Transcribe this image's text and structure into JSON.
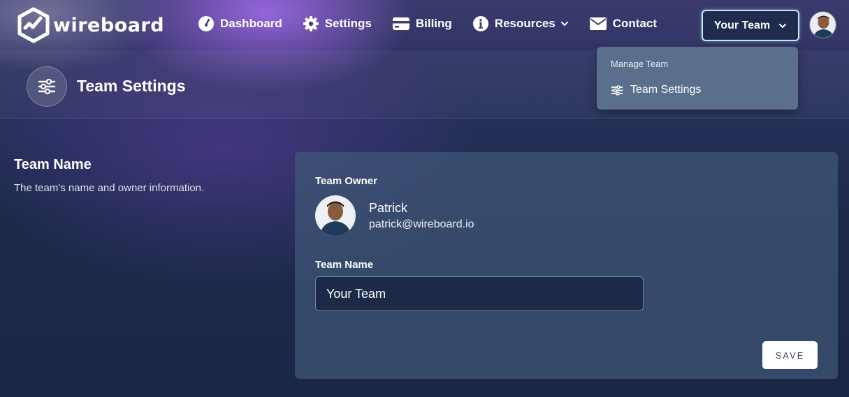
{
  "brand": {
    "name": "wireboard",
    "logo_icon": "hexagon-check-icon"
  },
  "nav": {
    "items": [
      {
        "label": "Dashboard",
        "icon": "gauge-icon"
      },
      {
        "label": "Settings",
        "icon": "gear-icon"
      },
      {
        "label": "Billing",
        "icon": "credit-card-icon"
      },
      {
        "label": "Resources",
        "icon": "info-icon",
        "has_dropdown": true
      },
      {
        "label": "Contact",
        "icon": "envelope-icon"
      }
    ]
  },
  "team_menu": {
    "button_label": "Your Team",
    "heading": "Manage Team",
    "items": [
      {
        "label": "Team Settings",
        "icon": "sliders-icon"
      }
    ]
  },
  "page_header": {
    "title": "Team Settings",
    "icon": "sliders-icon"
  },
  "section": {
    "title": "Team Name",
    "description": "The team's name and owner information."
  },
  "card": {
    "owner_label": "Team Owner",
    "owner": {
      "name": "Patrick",
      "email": "patrick@wireboard.io"
    },
    "name_label": "Team Name",
    "name_value": "Your Team",
    "save_label": "SAVE"
  },
  "colors": {
    "accent_outline": "#bfeef0",
    "dropdown_bg": "#5a6f8c",
    "card_bg": "#405878",
    "input_bg": "#1c2a48"
  }
}
